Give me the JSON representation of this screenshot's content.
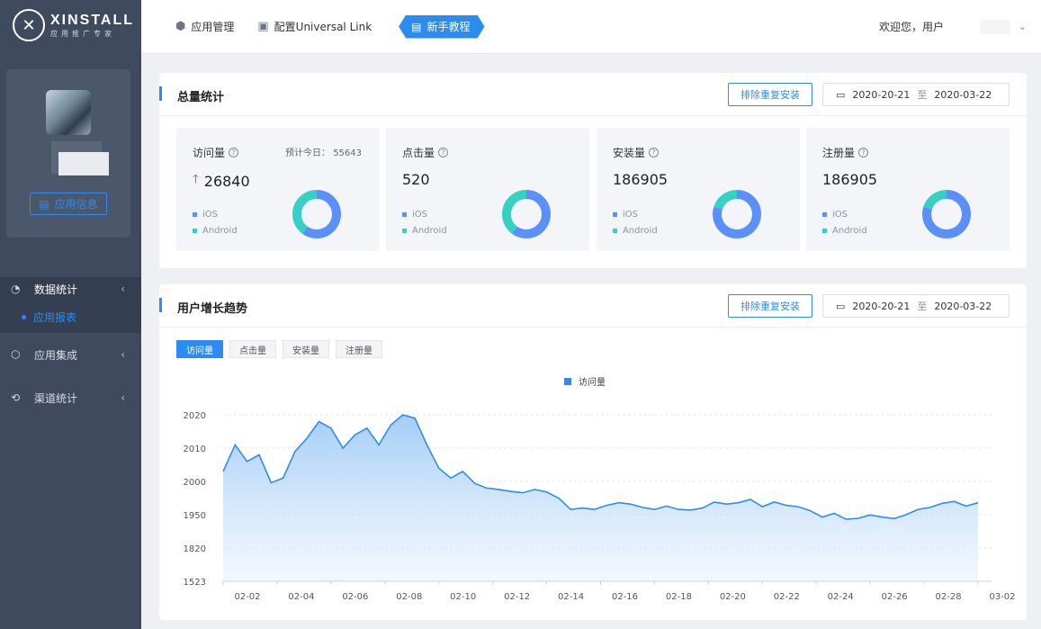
{
  "brand": {
    "name": "XINSTALL",
    "subtitle": "应用推广专家"
  },
  "profile": {
    "app_info_label": "应用信息"
  },
  "sidebar": {
    "items": [
      {
        "label": "数据统计",
        "icon": "pie-chart-icon",
        "active": true,
        "sub": [
          {
            "label": "应用报表"
          }
        ]
      },
      {
        "label": "应用集成",
        "icon": "cube-icon"
      },
      {
        "label": "渠道统计",
        "icon": "share-nodes-icon"
      }
    ]
  },
  "topbar": {
    "items": [
      {
        "label": "应用管理",
        "icon": "cube-icon"
      },
      {
        "label": "配置Universal Link",
        "icon": "briefcase-icon"
      }
    ],
    "tutorial": "新手教程",
    "welcome": "欢迎您，用户"
  },
  "summary": {
    "title": "总量统计",
    "dedup_label": "排除重复安装",
    "date_start": "2020-20-21",
    "date_sep": "至",
    "date_end": "2020-03-22",
    "stats": [
      {
        "label": "访问量",
        "value": "26840",
        "forecast_label": "预计今日：",
        "forecast_value": "55643",
        "trend": "up",
        "ios": 0.6,
        "android": 0.4
      },
      {
        "label": "点击量",
        "value": "520",
        "ios": 0.6,
        "android": 0.4
      },
      {
        "label": "安装量",
        "value": "186905",
        "ios": 0.8,
        "android": 0.2
      },
      {
        "label": "注册量",
        "value": "186905",
        "ios": 0.8,
        "android": 0.2
      }
    ],
    "legend_ios": "iOS",
    "legend_android": "Android",
    "colors": {
      "ios": "#5b8ff9",
      "android": "#36d1c4"
    }
  },
  "trend": {
    "title": "用户增长趋势",
    "dedup_label": "排除重复安装",
    "date_start": "2020-20-21",
    "date_sep": "至",
    "date_end": "2020-03-22",
    "tabs": [
      "访问量",
      "点击量",
      "安装量",
      "注册量"
    ],
    "active_tab": 0
  },
  "chart_data": {
    "type": "area",
    "series": [
      {
        "name": "访问量",
        "values": [
          2003,
          2011,
          2006,
          2008,
          1998,
          2001,
          2009,
          2013,
          2018,
          2016,
          2010,
          2014,
          2016,
          2011,
          2017,
          2020,
          2019,
          2011,
          2004,
          2001,
          2003,
          1997,
          1990,
          1988,
          1985,
          1983,
          1988,
          1984,
          1975,
          1958,
          1960,
          1958,
          1964,
          1968,
          1966,
          1961,
          1958,
          1963,
          1958,
          1957,
          1960,
          1969,
          1966,
          1968,
          1973,
          1962,
          1969,
          1964,
          1962,
          1956,
          1941,
          1952,
          1932,
          1936,
          1949,
          1941,
          1935,
          1950,
          1958,
          1961,
          1967,
          1970,
          1963,
          1968
        ]
      }
    ],
    "x": [
      "02-02",
      "02-02",
      "02-03",
      "02-03",
      "02-04",
      "02-04",
      "02-05",
      "02-05",
      "02-06",
      "02-06",
      "02-07",
      "02-07",
      "02-08",
      "02-08",
      "02-09",
      "02-09",
      "02-10",
      "02-10",
      "02-11",
      "02-11",
      "02-12",
      "02-12",
      "02-13",
      "02-13",
      "02-14",
      "02-14",
      "02-15",
      "02-15",
      "02-16",
      "02-16",
      "02-17",
      "02-17",
      "02-18",
      "02-18",
      "02-19",
      "02-19",
      "02-20",
      "02-20",
      "02-21",
      "02-21",
      "02-22",
      "02-22",
      "02-23",
      "02-23",
      "02-24",
      "02-24",
      "02-25",
      "02-25",
      "02-26",
      "02-26",
      "02-27",
      "02-27",
      "02-28",
      "02-28",
      "03-01",
      "03-01",
      "03-02",
      "03-02",
      "03-02",
      "03-02",
      "03-02",
      "03-02",
      "03-02",
      "03-02"
    ],
    "xticks": [
      "02-02",
      "02-04",
      "02-06",
      "02-08",
      "02-10",
      "02-12",
      "02-14",
      "02-16",
      "02-18",
      "02-20",
      "02-22",
      "02-24",
      "02-26",
      "02-28",
      "03-02"
    ],
    "yticks": [
      "2020",
      "2010",
      "2000",
      "1950",
      "1820",
      "1523"
    ],
    "legend": "访问量",
    "color": "#2d8cf0",
    "grid": true
  }
}
